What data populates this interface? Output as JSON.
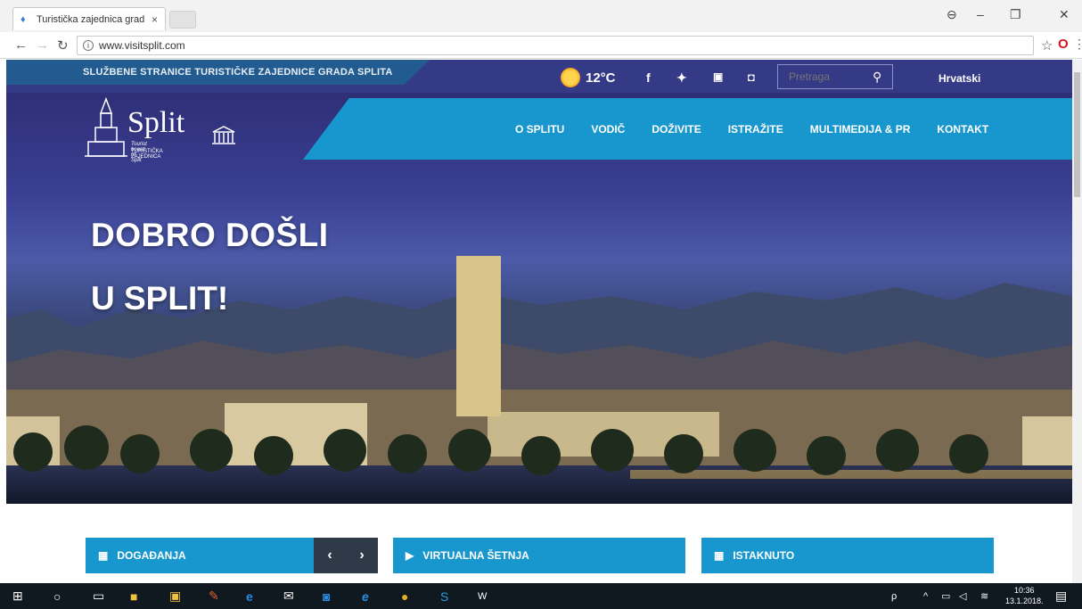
{
  "browser": {
    "tab_title": "Turistička zajednica grad",
    "tab_close": "×",
    "url": "www.visitsplit.com"
  },
  "site": {
    "official_text": "SLUŽBENE STRANICE TURISTIČKE ZAJEDNICE GRADA SPLITA",
    "temperature": "12°C",
    "search_placeholder": "Pretraga",
    "language": "Hrvatski",
    "logo_name": "Split",
    "logo_sub1": "Tourist board of Split",
    "logo_sub2": "TURISTIČKA ZAJEDNICA",
    "nav": [
      "O SPLITU",
      "VODIČ",
      "DOŽIVITE",
      "ISTRAŽITE",
      "MULTIMEDIJA & PR",
      "KONTAKT"
    ],
    "hero_line1": "DOBRO DOŠLI",
    "hero_line2": "U SPLIT!",
    "cards": {
      "events": "DOGAĐANJA",
      "virtual": "VIRTUALNA ŠETNJA",
      "featured": "ISTAKNUTO"
    }
  },
  "taskbar": {
    "time": "10:36",
    "date": "13.1.2018."
  }
}
